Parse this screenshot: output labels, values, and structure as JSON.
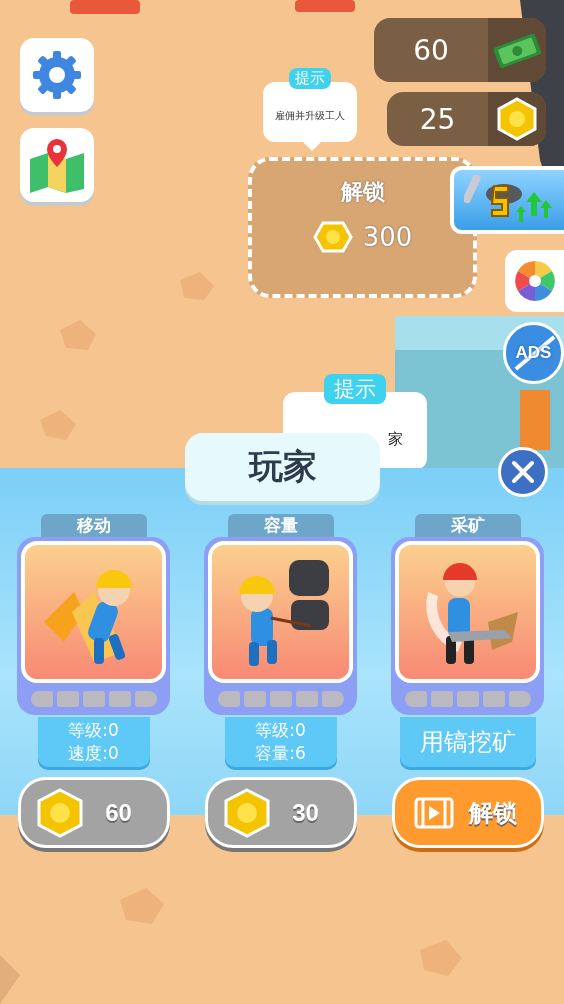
{
  "hud": {
    "side_buttons": [
      {
        "kind": "settings"
      },
      {
        "kind": "map"
      }
    ],
    "currencies": [
      {
        "kind": "cash",
        "value": "60"
      },
      {
        "kind": "coin",
        "value": "25"
      }
    ],
    "right_buttons": [
      {
        "kind": "boost"
      },
      {
        "kind": "wheel"
      },
      {
        "kind": "no_ads",
        "label": "ADS"
      }
    ]
  },
  "hints": [
    {
      "badge": "提示",
      "text": "雇佣并升级工人"
    },
    {
      "badge": "提示",
      "text": "家"
    }
  ],
  "unlock_zone": {
    "title": "解锁",
    "cost": "300"
  },
  "panel": {
    "title": "玩家",
    "upgrades": [
      {
        "name": "移动",
        "kind": "run",
        "level": 0,
        "lines": [
          "等级:0",
          "速度:0"
        ],
        "button": {
          "kind": "coin",
          "label": "60"
        }
      },
      {
        "name": "容量",
        "kind": "carry",
        "level": 0,
        "lines": [
          "等级:0",
          "容量:6"
        ],
        "button": {
          "kind": "coin",
          "label": "30"
        }
      },
      {
        "name": "采矿",
        "kind": "mine",
        "level": 0,
        "lines": [
          "用镐挖矿"
        ],
        "button": {
          "kind": "video",
          "label": "解锁"
        }
      }
    ]
  }
}
